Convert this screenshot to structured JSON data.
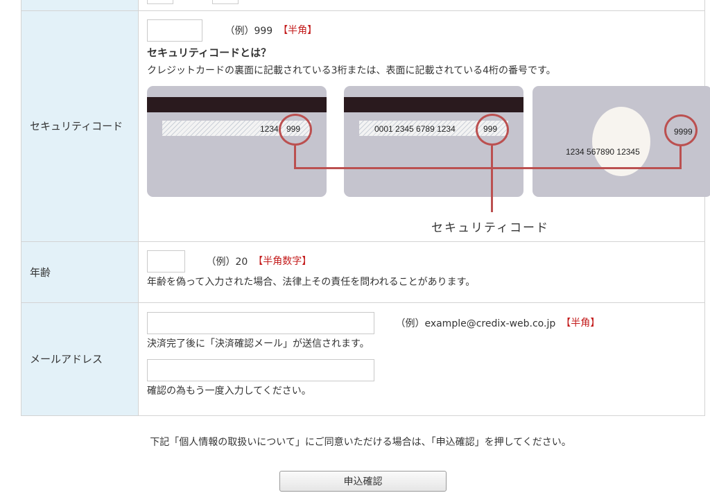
{
  "security": {
    "label": "セキュリティコード",
    "example": "（例）999",
    "hint": "【半角】",
    "title": "セキュリティコードとは？",
    "desc": "クレジットカードの裏面に記載されている3桁または、表面に記載されている4桁の番号です。",
    "card1_num": "1234",
    "card1_code": "999",
    "card2_num": "0001 2345 6789 1234",
    "card2_code": "999",
    "card3_num": "1234 567890 12345",
    "card3_code": "9999",
    "diagram_label": "セキュリティコード"
  },
  "age": {
    "label": "年齢",
    "example": "（例）20",
    "hint": "【半角数字】",
    "note": "年齢を偽って入力された場合、法律上その責任を問われることがあります。"
  },
  "email": {
    "label": "メールアドレス",
    "example": "（例）example@credix-web.co.jp",
    "hint": "【半角】",
    "note1": "決済完了後に「決済確認メール」が送信されます。",
    "note2": "確認の為もう一度入力してください。"
  },
  "notice": "下記「個人情報の取扱いについて」にご同意いただける場合は、「申込確認」を押してください。",
  "submit_label": "申込確認",
  "colors": {
    "header_bg": "#e3f1f8",
    "hint_red": "#c31b1b",
    "diagram_red": "#bb5050"
  }
}
